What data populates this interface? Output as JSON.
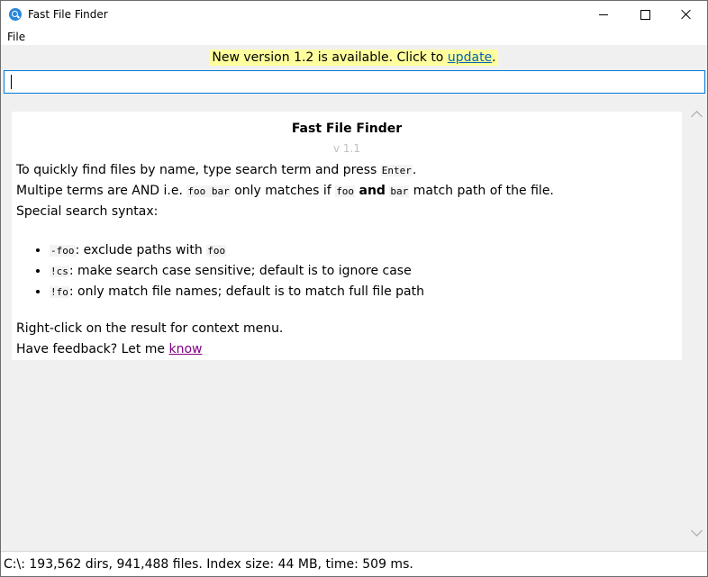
{
  "window": {
    "title": "Fast File Finder",
    "icon": "search-magnifier-icon"
  },
  "menu": {
    "file_label": "File"
  },
  "notice": {
    "text": "New version 1.2 is available. Click to",
    "link_label": "update",
    "suffix": "."
  },
  "search": {
    "value": "",
    "placeholder": ""
  },
  "welcome": {
    "title": "Fast File Finder",
    "version": "v 1.1",
    "line1_a": "To quickly find files by name, type search term and press",
    "line1_code": "Enter",
    "line1_b": ".",
    "line2_a": "Multipe terms are AND i.e.",
    "line2_code1": "foo bar",
    "line2_b": "only matches if",
    "line2_code2": "foo",
    "line2_and": "and",
    "line2_code3": "bar",
    "line2_c": "match path of the file.",
    "line3": "Special search syntax:",
    "bullets": [
      {
        "code": "-foo",
        "text": ": exclude paths with",
        "code2": "foo"
      },
      {
        "code": "!cs",
        "text": ": make search case sensitive; default is to ignore case",
        "code2": ""
      },
      {
        "code": "!fo",
        "text": ": only match file names; default is to match full file path",
        "code2": ""
      }
    ],
    "line4": "Right-click on the result for context menu.",
    "line5_a": "Have feedback? Let me",
    "line5_link": "know"
  },
  "status": {
    "text": "C:\\: 193,562 dirs, 941,488 files. Index size: 44 MB, time: 509 ms."
  },
  "colors": {
    "accent": "#0078d7",
    "notice_bg": "#ffff9e",
    "link": "#0063b1",
    "visited_link": "#800080"
  }
}
